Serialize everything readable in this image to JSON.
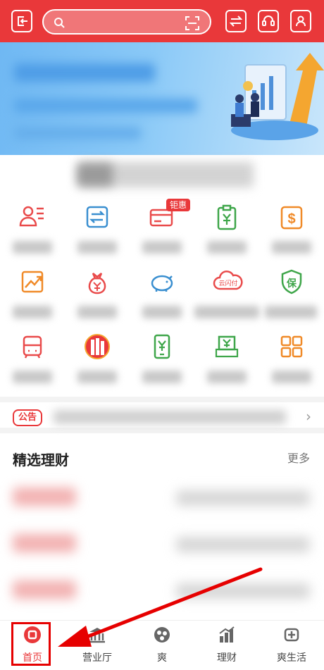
{
  "topbar": {
    "search": {
      "placeholder": ""
    },
    "icons": [
      "exit-icon",
      "scan-icon",
      "transfer-icon",
      "customer-service-icon",
      "profile-icon"
    ]
  },
  "services": {
    "badge": "钜惠",
    "icons": [
      "user-list-icon",
      "transfer-icon",
      "card-icon",
      "clipboard-yuan-icon",
      "dollar-icon",
      "trend-icon",
      "money-bag-icon",
      "piggy-bank-icon",
      "cloud-pay-icon",
      "shield-bao-icon",
      "bus-icon",
      "brand-logo-icon",
      "phone-yuan-icon",
      "receipt-icon",
      "grid-icon"
    ],
    "badge_pay_text": "云闪付",
    "badge_shield_text": "保"
  },
  "notice": {
    "tag": "公告"
  },
  "featured": {
    "title": "精选理财",
    "more": "更多"
  },
  "tabbar": {
    "tabs": [
      {
        "label": "首页",
        "icon": "home-icon",
        "active": true
      },
      {
        "label": "营业厅",
        "icon": "bank-icon"
      },
      {
        "label": "爽",
        "icon": "shuang-icon"
      },
      {
        "label": "理财",
        "icon": "chart-icon"
      },
      {
        "label": "爽生活",
        "icon": "life-icon"
      }
    ]
  },
  "colors": {
    "brand": "#e9383a",
    "orange": "#f08a28",
    "green": "#3fa64a",
    "blue": "#3a8fd0"
  }
}
